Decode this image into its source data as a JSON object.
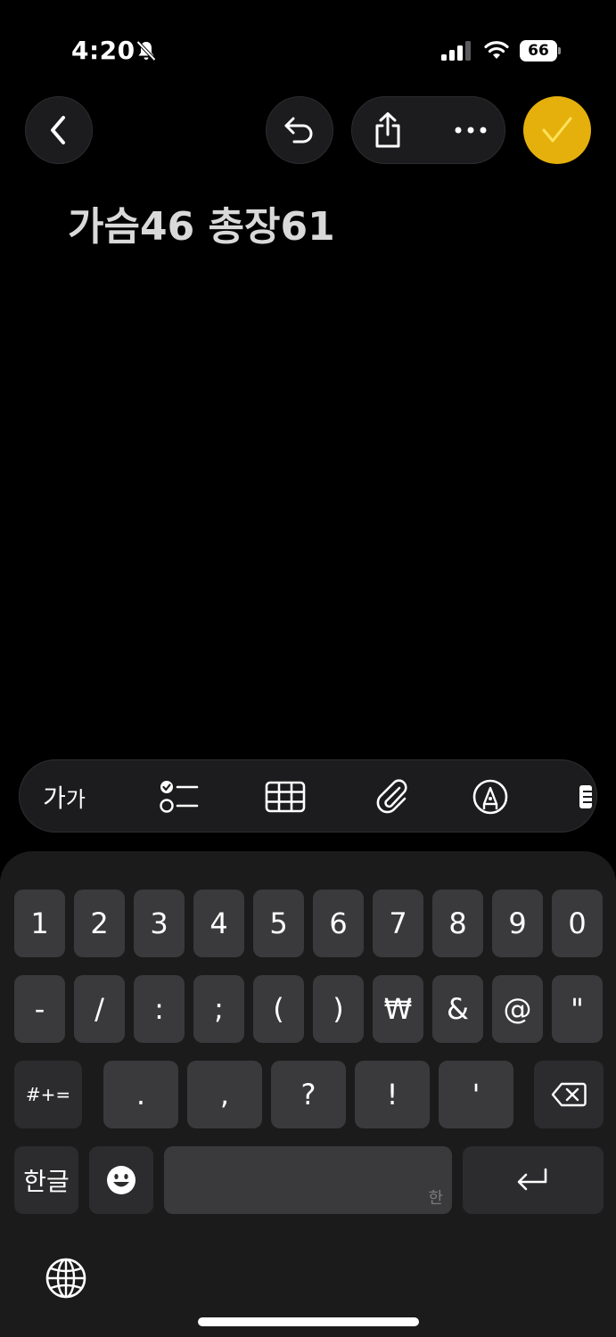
{
  "status_bar": {
    "time": "4:20",
    "battery_level": "66",
    "icons": [
      "bell-slash-icon",
      "cellular-signal-icon",
      "wifi-icon",
      "battery-icon"
    ]
  },
  "nav": {
    "icons": [
      "chevron-left-icon",
      "undo-icon",
      "share-icon",
      "more-icon",
      "checkmark-icon"
    ],
    "accent_color": "#E6B00C"
  },
  "note": {
    "text": "가슴46 총장61"
  },
  "toolbar": {
    "format_label_large": "가",
    "format_label_small": "가",
    "icons": [
      "text-format-icon",
      "checklist-icon",
      "table-icon",
      "paperclip-icon",
      "markup-pen-icon",
      "more-tools-icon"
    ]
  },
  "keyboard": {
    "row1": [
      "1",
      "2",
      "3",
      "4",
      "5",
      "6",
      "7",
      "8",
      "9",
      "0"
    ],
    "row2": [
      "-",
      "/",
      ":",
      ";",
      "(",
      ")",
      "₩",
      "&",
      "@",
      "\""
    ],
    "row3_symbols_key": "#+=",
    "row3": [
      ".",
      ",",
      "?",
      "!",
      "'"
    ],
    "language_key": "한글",
    "space_hint": "한",
    "icons": [
      "delete-icon",
      "emoji-icon",
      "return-icon",
      "globe-icon"
    ]
  }
}
